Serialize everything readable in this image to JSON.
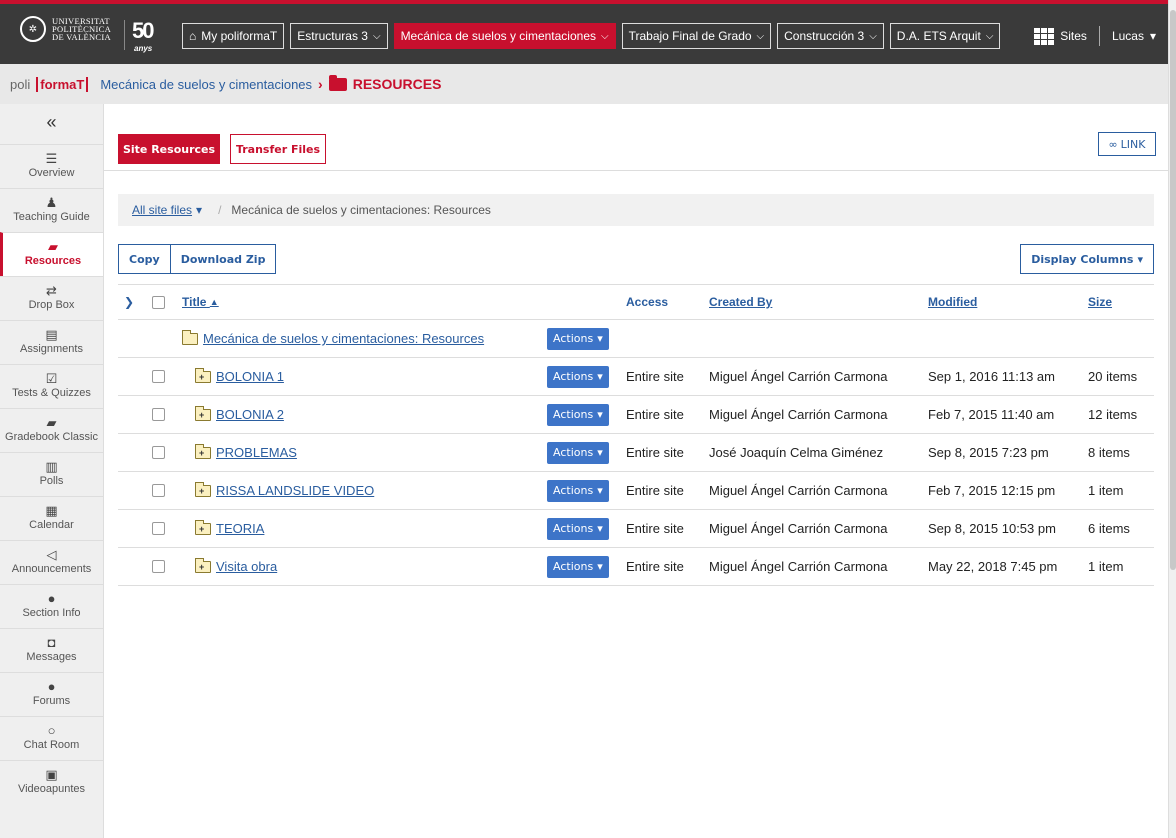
{
  "topbar": {
    "uni_lines": [
      "UNIVERSITAT",
      "POLITÈCNICA",
      "DE VALÈNCIA"
    ],
    "anniv_num": "50",
    "anniv_lbl": "anys",
    "nav": [
      {
        "label": "My poliformaT",
        "icon": "home-icon",
        "active": false,
        "dropdown": false
      },
      {
        "label": "Estructuras 3",
        "active": false,
        "dropdown": true
      },
      {
        "label": "Mecánica de suelos y cimentaciones",
        "active": true,
        "dropdown": true
      },
      {
        "label": "Trabajo Final de Grado",
        "active": false,
        "dropdown": true
      },
      {
        "label": "Construcción 3",
        "active": false,
        "dropdown": true
      },
      {
        "label": "D.A. ETS Arquit",
        "active": false,
        "dropdown": true
      }
    ],
    "sites_label": "Sites",
    "user_label": "Lucas"
  },
  "crumb": {
    "poli": "poli",
    "format": "formaT",
    "site": "Mecánica de suelos y cimentaciones",
    "tool": "RESOURCES"
  },
  "sidebar": {
    "collapse": "«",
    "items": [
      {
        "label": "Overview",
        "icon": "≣"
      },
      {
        "label": "Teaching Guide",
        "icon": "👥"
      },
      {
        "label": "Resources",
        "icon": "▰",
        "active": true
      },
      {
        "label": "Drop Box",
        "icon": "⇄"
      },
      {
        "label": "Assignments",
        "icon": "▤"
      },
      {
        "label": "Tests & Quizzes",
        "icon": "☑"
      },
      {
        "label": "Gradebook Classic",
        "icon": "▰"
      },
      {
        "label": "Polls",
        "icon": "▥"
      },
      {
        "label": "Calendar",
        "icon": "▦"
      },
      {
        "label": "Announcements",
        "icon": "◁"
      },
      {
        "label": "Section Info",
        "icon": "●"
      },
      {
        "label": "Messages",
        "icon": "◘"
      },
      {
        "label": "Forums",
        "icon": "●"
      },
      {
        "label": "Chat Room",
        "icon": "○"
      },
      {
        "label": "Videoapuntes",
        "icon": "▣"
      }
    ]
  },
  "main": {
    "site_resources": "Site Resources",
    "transfer_files": "Transfer Files",
    "link": "LINK",
    "all_site_files": "All site files",
    "path_current": "Mecánica de suelos y cimentaciones: Resources",
    "copy": "Copy",
    "download_zip": "Download Zip",
    "display_columns": "Display Columns",
    "headers": {
      "title": "Title",
      "access": "Access",
      "created_by": "Created By",
      "modified": "Modified",
      "size": "Size"
    },
    "actions_label": "Actions",
    "root": "Mecánica de suelos y cimentaciones: Resources",
    "rows": [
      {
        "title": "BOLONIA 1",
        "access": "Entire site",
        "created_by": "Miguel Ángel Carrión Carmona",
        "modified": "Sep 1, 2016 11:13 am",
        "size": "20 items"
      },
      {
        "title": "BOLONIA 2",
        "access": "Entire site",
        "created_by": "Miguel Ángel Carrión Carmona",
        "modified": "Feb 7, 2015 11:40 am",
        "size": "12 items"
      },
      {
        "title": "PROBLEMAS",
        "access": "Entire site",
        "created_by": "José Joaquín Celma Giménez",
        "modified": "Sep 8, 2015 7:23 pm",
        "size": "8 items"
      },
      {
        "title": "RISSA LANDSLIDE VIDEO",
        "access": "Entire site",
        "created_by": "Miguel Ángel Carrión Carmona",
        "modified": "Feb 7, 2015 12:15 pm",
        "size": "1 item"
      },
      {
        "title": "TEORIA",
        "access": "Entire site",
        "created_by": "Miguel Ángel Carrión Carmona",
        "modified": "Sep 8, 2015 10:53 pm",
        "size": "6 items"
      },
      {
        "title": "Visita obra",
        "access": "Entire site",
        "created_by": "Miguel Ángel Carrión Carmona",
        "modified": "May 22, 2018 7:45 pm",
        "size": "1 item"
      }
    ]
  }
}
